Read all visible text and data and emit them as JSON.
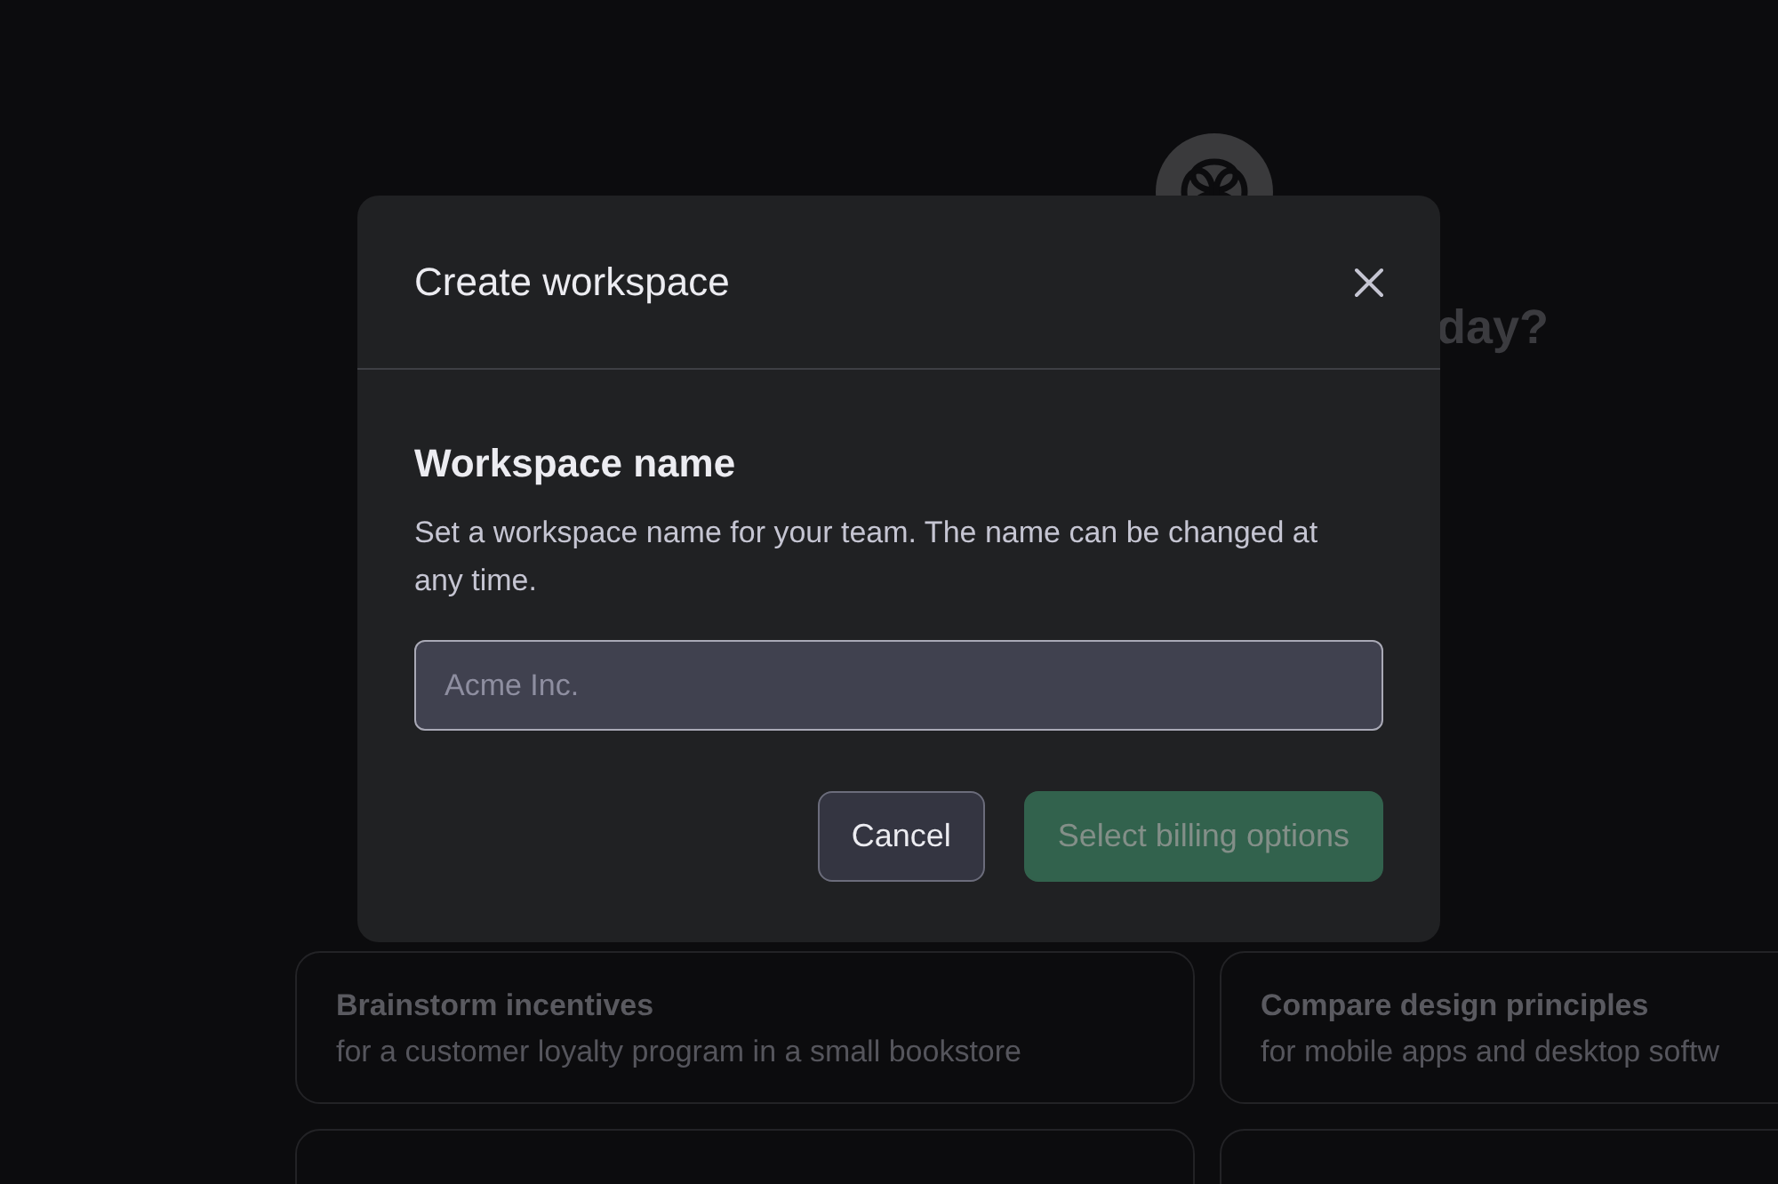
{
  "background": {
    "heading": "day?",
    "suggestions": [
      {
        "title": "Brainstorm incentives",
        "subtitle": "for a customer loyalty program in a small bookstore"
      },
      {
        "title": "Compare design principles",
        "subtitle": "for mobile apps and desktop softw"
      }
    ]
  },
  "dialog": {
    "title": "Create workspace",
    "section_title": "Workspace name",
    "description": "Set a workspace name for your team. The name can be changed at any time.",
    "name_field": {
      "placeholder": "Acme Inc."
    },
    "buttons": [
      {
        "label": "Cancel",
        "kind": "secondary",
        "disabled": false
      },
      {
        "label": "Select billing options",
        "kind": "primary",
        "disabled": true
      }
    ]
  }
}
